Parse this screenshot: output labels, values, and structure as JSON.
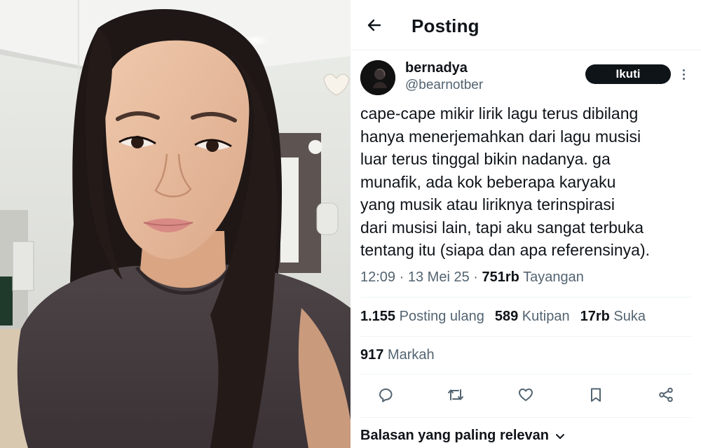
{
  "header": {
    "title": "Posting",
    "back_icon": "arrow-left-icon"
  },
  "author": {
    "display_name": "bernadya",
    "handle": "@bearnotber",
    "follow_label": "Ikuti",
    "more_icon": "more-vertical-icon"
  },
  "post": {
    "text": "cape-cape mikir lirik lagu terus dibilang\nhanya menerjemahkan dari lagu musisi\nluar terus tinggal bikin nadanya. ga\nmunafik, ada kok beberapa karyaku\nyang musik atau liriknya terinspirasi\ndari musisi lain, tapi aku sangat terbuka\ntentang itu (siapa dan apa referensinya).",
    "time": "12:09",
    "separator": "·",
    "date": "13 Mei 25",
    "views_count": "751rb",
    "views_label": "Tayangan"
  },
  "stats": {
    "reposts_count": "1.155",
    "reposts_label": "Posting ulang",
    "quotes_count": "589",
    "quotes_label": "Kutipan",
    "likes_count": "17rb",
    "likes_label": "Suka",
    "bookmarks_count": "917",
    "bookmarks_label": "Markah"
  },
  "actions": [
    "reply-icon",
    "repost-icon",
    "like-icon",
    "bookmark-icon",
    "share-icon"
  ],
  "replies": {
    "sort_label": "Balasan yang paling relevan",
    "sort_icon": "chevron-down-icon"
  },
  "colors": {
    "text_primary": "#0f1419",
    "text_secondary": "#536471",
    "divider": "#eff3f4",
    "follow_bg": "#0f1419",
    "follow_text": "#ffffff"
  }
}
